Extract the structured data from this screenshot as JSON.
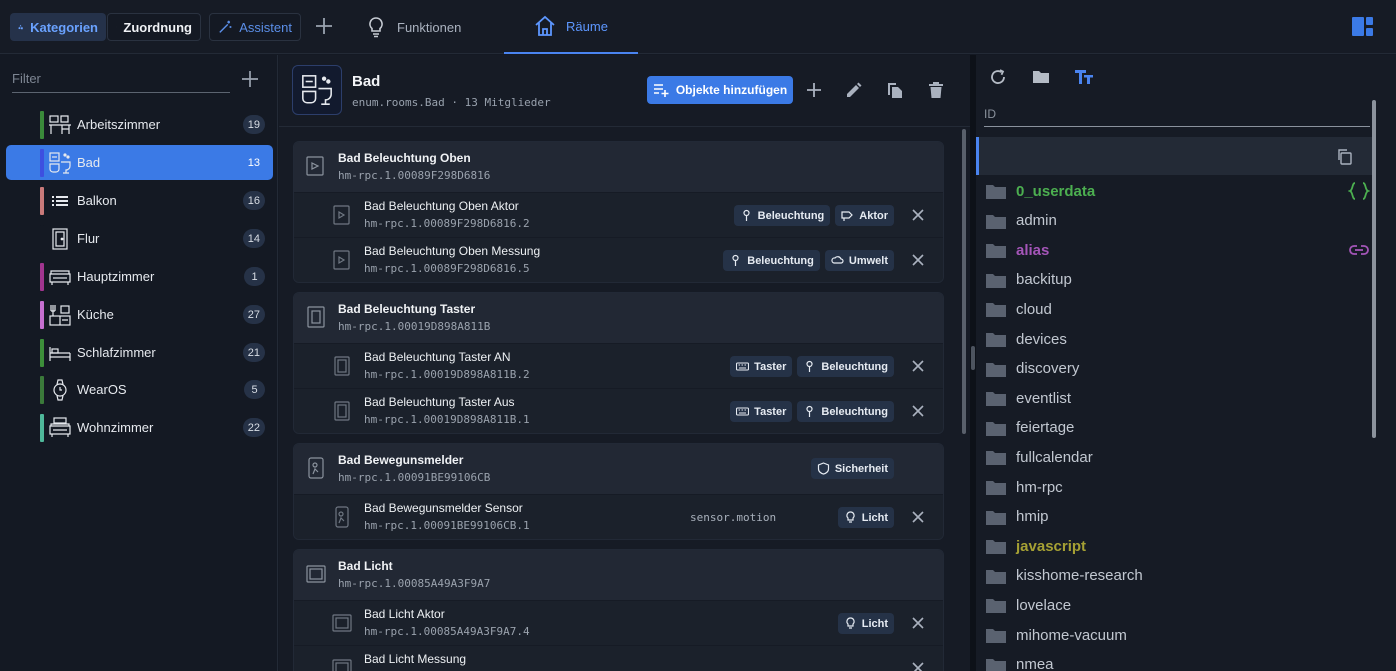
{
  "topbar": {
    "kategorien": "Kategorien",
    "zuordnung": "Zuordnung",
    "assistent": "Assistent",
    "tab_funktionen": "Funktionen",
    "tab_raeume": "Räume"
  },
  "left": {
    "filter_placeholder": "Filter",
    "rooms": [
      {
        "label": "Arbeitszimmer",
        "count": "19",
        "color": "#3a8a3a"
      },
      {
        "label": "Bad",
        "count": "13",
        "color": "#3d4fe0"
      },
      {
        "label": "Balkon",
        "count": "16",
        "color": "#c97a7a"
      },
      {
        "label": "Flur",
        "count": "14",
        "color": "#141923"
      },
      {
        "label": "Hauptzimmer",
        "count": "1",
        "color": "#a1358f"
      },
      {
        "label": "Küche",
        "count": "27",
        "color": "#c66fd0"
      },
      {
        "label": "Schlafzimmer",
        "count": "21",
        "color": "#3d8f3a"
      },
      {
        "label": "WearOS",
        "count": "5",
        "color": "#3b7a3a"
      },
      {
        "label": "Wohnzimmer",
        "count": "22",
        "color": "#4fb89a"
      }
    ]
  },
  "center": {
    "title": "Bad",
    "subtitle": "enum.rooms.Bad · 13 Mitglieder",
    "add_objects": "Objekte hinzufügen",
    "groups": [
      {
        "name": "Bad Beleuchtung Oben",
        "id": "hm-rpc.1.00089F298D6816",
        "items": [
          {
            "name": "Bad Beleuchtung Oben Aktor",
            "id": "hm-rpc.1.00089F298D6816.2",
            "chips": [
              "Beleuchtung",
              "Aktor"
            ]
          },
          {
            "name": "Bad Beleuchtung Oben Messung",
            "id": "hm-rpc.1.00089F298D6816.5",
            "chips": [
              "Beleuchtung",
              "Umwelt"
            ]
          }
        ]
      },
      {
        "name": "Bad Beleuchtung Taster",
        "id": "hm-rpc.1.00019D898A811B",
        "items": [
          {
            "name": "Bad Beleuchtung Taster AN",
            "id": "hm-rpc.1.00019D898A811B.2",
            "chips": [
              "Taster",
              "Beleuchtung"
            ]
          },
          {
            "name": "Bad Beleuchtung Taster Aus",
            "id": "hm-rpc.1.00019D898A811B.1",
            "chips": [
              "Taster",
              "Beleuchtung"
            ]
          }
        ]
      },
      {
        "name": "Bad Bewegunsmelder",
        "id": "hm-rpc.1.00091BE99106CB",
        "chip": "Sicherheit",
        "items": [
          {
            "name": "Bad Bewegunsmelder Sensor",
            "id": "hm-rpc.1.00091BE99106CB.1",
            "role": "sensor.motion",
            "chips": [
              "Licht"
            ]
          }
        ]
      },
      {
        "name": "Bad Licht",
        "id": "hm-rpc.1.00085A49A3F9A7",
        "items": [
          {
            "name": "Bad Licht Aktor",
            "id": "hm-rpc.1.00085A49A3F9A7.4",
            "chips": [
              "Licht"
            ]
          },
          {
            "name": "Bad Licht Messung",
            "id": "",
            "chips": []
          }
        ]
      }
    ]
  },
  "right": {
    "id_placeholder": "ID",
    "objects": [
      {
        "label": "0_userdata",
        "color": "#4caf50",
        "bold": true,
        "extra": "braces"
      },
      {
        "label": "admin",
        "color": "#c2c8d1",
        "bold": false
      },
      {
        "label": "alias",
        "color": "#a455b8",
        "bold": true,
        "extra": "link"
      },
      {
        "label": "backitup",
        "color": "#c2c8d1",
        "bold": false
      },
      {
        "label": "cloud",
        "color": "#c2c8d1",
        "bold": false
      },
      {
        "label": "devices",
        "color": "#c2c8d1",
        "bold": false
      },
      {
        "label": "discovery",
        "color": "#c2c8d1",
        "bold": false
      },
      {
        "label": "eventlist",
        "color": "#c2c8d1",
        "bold": false
      },
      {
        "label": "feiertage",
        "color": "#c2c8d1",
        "bold": false
      },
      {
        "label": "fullcalendar",
        "color": "#c2c8d1",
        "bold": false
      },
      {
        "label": "hm-rpc",
        "color": "#c2c8d1",
        "bold": false
      },
      {
        "label": "hmip",
        "color": "#c2c8d1",
        "bold": false
      },
      {
        "label": "javascript",
        "color": "#a5a034",
        "bold": true
      },
      {
        "label": "kisshome-research",
        "color": "#c2c8d1",
        "bold": false
      },
      {
        "label": "lovelace",
        "color": "#c2c8d1",
        "bold": false
      },
      {
        "label": "mihome-vacuum",
        "color": "#c2c8d1",
        "bold": false
      },
      {
        "label": "nmea",
        "color": "#c2c8d1",
        "bold": false
      }
    ]
  }
}
